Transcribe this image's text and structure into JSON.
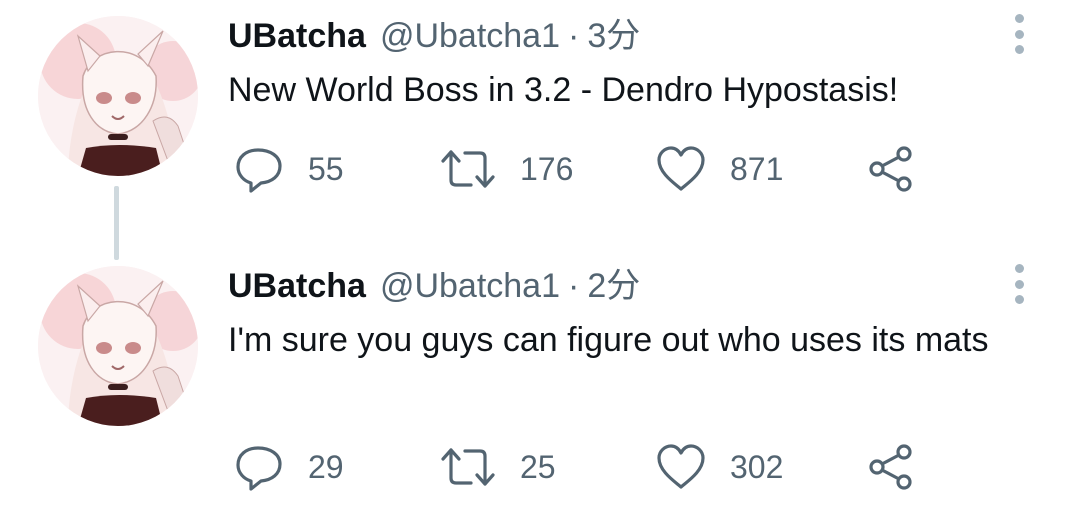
{
  "colors": {
    "text": "#0f1419",
    "secondary": "#536471",
    "thread_line": "#cfd9de",
    "icon": "#536471"
  },
  "tweets": [
    {
      "name": "UBatcha",
      "handle": "@Ubatcha1",
      "separator": "·",
      "time": "3分",
      "text": "New World Boss in 3.2 - Dendro Hypostasis!",
      "replies": "55",
      "retweets": "176",
      "likes": "871",
      "icons": {
        "reply": "reply-icon",
        "retweet": "retweet-icon",
        "like": "heart-icon",
        "share": "share-icon",
        "more": "more-options-icon"
      }
    },
    {
      "name": "UBatcha",
      "handle": "@Ubatcha1",
      "separator": "·",
      "time": "2分",
      "text": "I'm sure you guys can figure out who uses its mats",
      "replies": "29",
      "retweets": "25",
      "likes": "302",
      "icons": {
        "reply": "reply-icon",
        "retweet": "retweet-icon",
        "like": "heart-icon",
        "share": "share-icon",
        "more": "more-options-icon"
      }
    }
  ]
}
